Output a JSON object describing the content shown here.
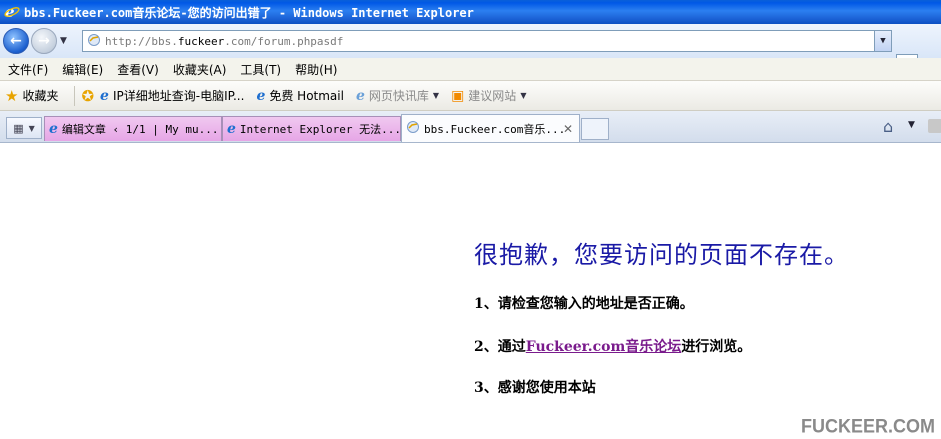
{
  "window": {
    "title": "bbs.Fuckeer.com音乐论坛-您的访问出错了 - Windows Internet Explorer"
  },
  "address": {
    "prefix": "http://bbs.",
    "host": "fuckeer",
    "suffix": ".com/forum.phpasdf"
  },
  "menu": [
    "文件(F)",
    "编辑(E)",
    "查看(V)",
    "收藏夹(A)",
    "工具(T)",
    "帮助(H)"
  ],
  "favorites": {
    "label": "收藏夹",
    "items": [
      "IP详细地址查询-电脑IP...",
      "免费 Hotmail",
      "网页快讯库",
      "建议网站"
    ]
  },
  "tabs": [
    {
      "label": "编辑文章 ‹ 1/1 | My mu..."
    },
    {
      "label": "Internet Explorer 无法..."
    },
    {
      "label": "bbs.Fuckeer.com音乐...",
      "close": "✕"
    }
  ],
  "content": {
    "heading": "很抱歉，您要访问的页面不存在。",
    "line1": "1、请检查您输入的地址是否正确。",
    "line2_prefix": "2、通过",
    "line2_link": "Fuckeer.com音乐论坛",
    "line2_suffix": "进行浏览。",
    "line3": "3、感谢您使用本站"
  },
  "watermark": "FUCKEER.COM",
  "colors": {
    "titlebar": "#0058e6",
    "heading": "#1a1aa6",
    "link": "#7a1b8c",
    "tab_inactive": "#e6a6e6"
  }
}
